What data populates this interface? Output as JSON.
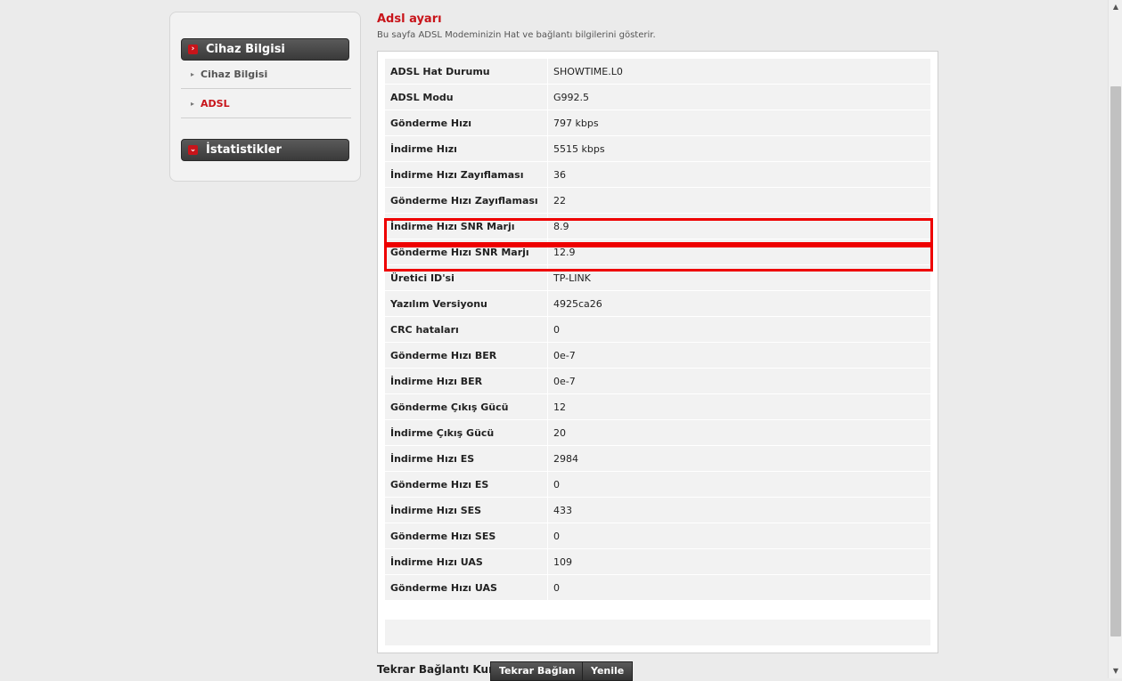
{
  "sidebar": {
    "section1": {
      "title": "Cihaz Bilgisi"
    },
    "items": [
      {
        "label": "Cihaz Bilgisi",
        "active": false
      },
      {
        "label": "ADSL",
        "active": true
      }
    ],
    "section2": {
      "title": "İstatistikler"
    }
  },
  "page": {
    "title": "Adsl ayarı",
    "subtitle": "Bu sayfa ADSL Modeminizin Hat ve bağlantı bilgilerini gösterir."
  },
  "rows": [
    {
      "label": "ADSL Hat Durumu",
      "value": "SHOWTIME.L0"
    },
    {
      "label": "ADSL Modu",
      "value": "G992.5"
    },
    {
      "label": "Gönderme Hızı",
      "value": "797 kbps"
    },
    {
      "label": "İndirme Hızı",
      "value": "5515 kbps"
    },
    {
      "label": "İndirme Hızı Zayıflaması",
      "value": "36"
    },
    {
      "label": "Gönderme Hızı Zayıflaması",
      "value": "22"
    },
    {
      "label": "İndirme Hızı SNR Marjı",
      "value": "8.9",
      "highlighted": true
    },
    {
      "label": "Gönderme Hızı SNR Marjı",
      "value": "12.9",
      "highlighted": true
    },
    {
      "label": "Üretici ID'si",
      "value": "TP-LINK"
    },
    {
      "label": "Yazılım Versiyonu",
      "value": "4925ca26"
    },
    {
      "label": "CRC hataları",
      "value": "0"
    },
    {
      "label": "Gönderme Hızı BER",
      "value": "0e-7"
    },
    {
      "label": "İndirme Hızı BER",
      "value": "0e-7"
    },
    {
      "label": "Gönderme Çıkış Gücü",
      "value": "12"
    },
    {
      "label": "İndirme Çıkış Gücü",
      "value": "20"
    },
    {
      "label": "İndirme Hızı ES",
      "value": "2984"
    },
    {
      "label": "Gönderme Hızı ES",
      "value": "0"
    },
    {
      "label": "İndirme Hızı SES",
      "value": "433"
    },
    {
      "label": "Gönderme Hızı SES",
      "value": "0"
    },
    {
      "label": "İndirme Hızı UAS",
      "value": "109"
    },
    {
      "label": "Gönderme Hızı UAS",
      "value": "0"
    }
  ],
  "footer": {
    "reconnect_label": "Tekrar Bağlantı Kur:",
    "reconnect_button": "Tekrar Bağlan",
    "refresh_button": "Yenile"
  },
  "colors": {
    "accent": "#c8141a",
    "highlight_box": "#ee0000",
    "header_dark": "#3a3a3a"
  }
}
